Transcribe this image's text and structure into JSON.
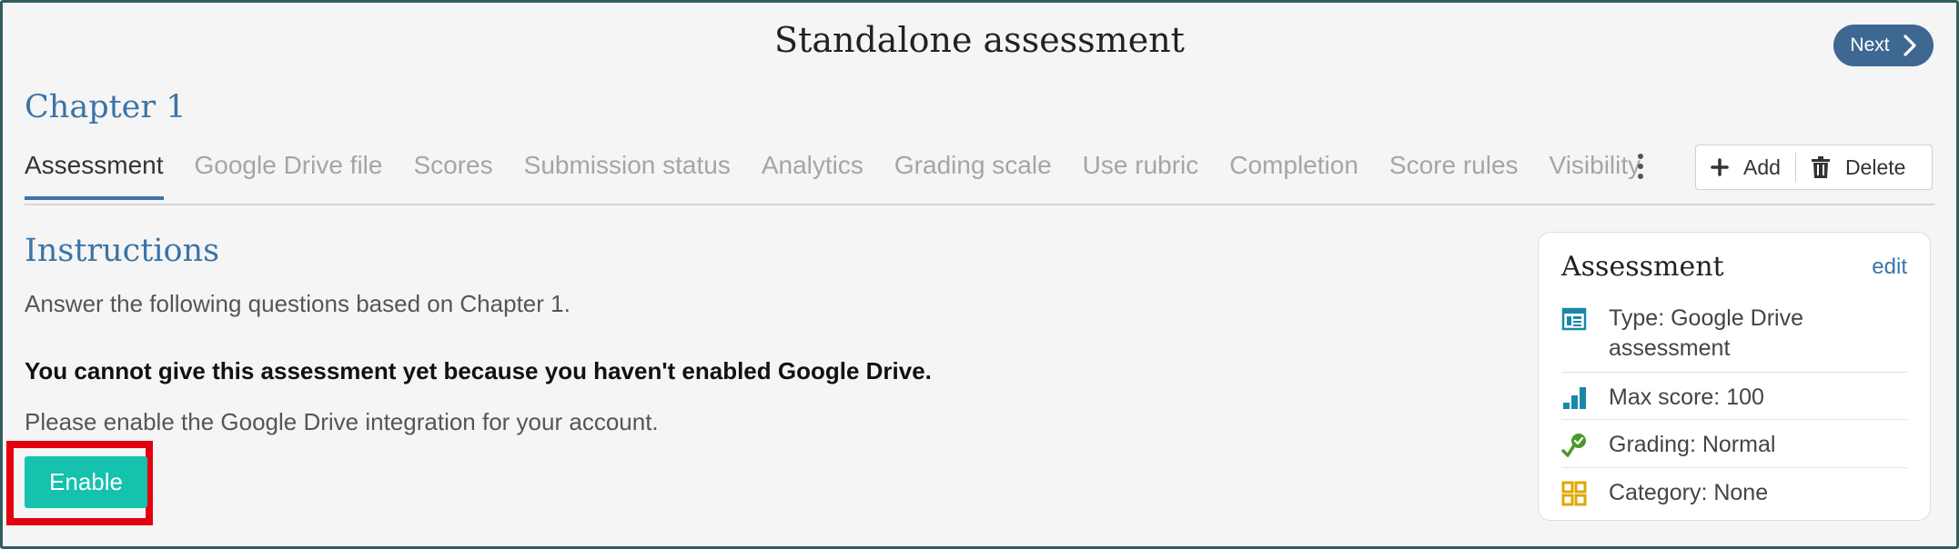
{
  "header": {
    "title": "Standalone assessment",
    "next_label": "Next"
  },
  "chapter": "Chapter 1",
  "tabs": [
    {
      "label": "Assessment",
      "active": true
    },
    {
      "label": "Google Drive file"
    },
    {
      "label": "Scores"
    },
    {
      "label": "Submission status"
    },
    {
      "label": "Analytics"
    },
    {
      "label": "Grading scale"
    },
    {
      "label": "Use rubric"
    },
    {
      "label": "Completion"
    },
    {
      "label": "Score rules"
    },
    {
      "label": "Visibility"
    }
  ],
  "actions": {
    "add_label": "Add",
    "delete_label": "Delete"
  },
  "instructions": {
    "title": "Instructions",
    "text": "Answer the following questions based on Chapter 1.",
    "warning": "You cannot give this assessment yet because you haven't enabled Google Drive.",
    "enable_text": "Please enable the Google Drive integration for your account.",
    "enable_button": "Enable"
  },
  "card": {
    "title": "Assessment",
    "edit_label": "edit",
    "rows": [
      {
        "icon": "google-drive-assessment-icon",
        "text": "Type: Google Drive assessment"
      },
      {
        "icon": "bar-chart-icon",
        "text": "Max score: 100"
      },
      {
        "icon": "grading-check-icon",
        "text": "Grading: Normal"
      },
      {
        "icon": "category-grid-icon",
        "text": "Category: None"
      }
    ]
  },
  "colors": {
    "accent_blue": "#3a74a8",
    "next_button": "#3e6891",
    "enable_button": "#14c2ad",
    "highlight": "#e3000f",
    "grading_green": "#4a9a2a",
    "category_yellow": "#e0a800"
  }
}
